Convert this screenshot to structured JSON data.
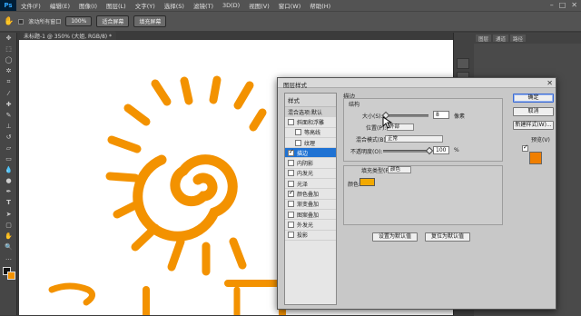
{
  "app": {
    "logo": "Ps"
  },
  "menu": [
    "文件(F)",
    "编辑(E)",
    "图像(I)",
    "图层(L)",
    "文字(Y)",
    "选择(S)",
    "滤镜(T)",
    "3D(D)",
    "视图(V)",
    "窗口(W)",
    "帮助(H)"
  ],
  "window_controls": [
    "–",
    "□",
    "✕"
  ],
  "options": {
    "scroll_all": "滚动所有窗口",
    "zoom": "100%",
    "fit_screen": "适合屏幕",
    "fill_screen": "填充屏幕"
  },
  "document_tab": "未标题-1 @ 350% (大姐, RGB/8) *",
  "right_tabs": [
    "图层",
    "通道",
    "路径"
  ],
  "dialog": {
    "title": "图层样式",
    "close": "✕",
    "styles_header": "样式",
    "blend_default": "混合选项:默认",
    "items": [
      {
        "label": "斜面和浮雕",
        "checked": false,
        "indent": false
      },
      {
        "label": "等高线",
        "checked": false,
        "indent": true
      },
      {
        "label": "纹理",
        "checked": false,
        "indent": true
      },
      {
        "label": "描边",
        "checked": true,
        "indent": false,
        "selected": true
      },
      {
        "label": "内阴影",
        "checked": false,
        "indent": false
      },
      {
        "label": "内发光",
        "checked": false,
        "indent": false
      },
      {
        "label": "光泽",
        "checked": false,
        "indent": false
      },
      {
        "label": "颜色叠加",
        "checked": true,
        "indent": false
      },
      {
        "label": "渐变叠加",
        "checked": false,
        "indent": false
      },
      {
        "label": "图案叠加",
        "checked": false,
        "indent": false
      },
      {
        "label": "外发光",
        "checked": false,
        "indent": false
      },
      {
        "label": "投影",
        "checked": false,
        "indent": false
      }
    ],
    "stroke": {
      "title": "描边",
      "structure": "结构",
      "size_label": "大小(S):",
      "size_value": "8",
      "size_unit": "像素",
      "size_fraction": 0.05,
      "position_label": "位置(P):",
      "position_value": "外部",
      "blend_label": "混合模式(B):",
      "blend_value": "正常",
      "opacity_label": "不透明度(O):",
      "opacity_value": "100",
      "opacity_unit": "%",
      "opacity_fraction": 1.0,
      "fill_type_label": "填充类型(F):",
      "fill_type_value": "颜色",
      "color_label": "颜色:",
      "color": "#f2a900"
    },
    "set_default": "设置为默认值",
    "reset_default": "复位为默认值",
    "ok": "确定",
    "cancel": "取消",
    "new_style": "新建样式(W)...",
    "preview": "预览(V)",
    "preview_swatch": "#f07f00"
  },
  "colors": {
    "orange": "#f39200",
    "accent": "#1f72d3"
  }
}
